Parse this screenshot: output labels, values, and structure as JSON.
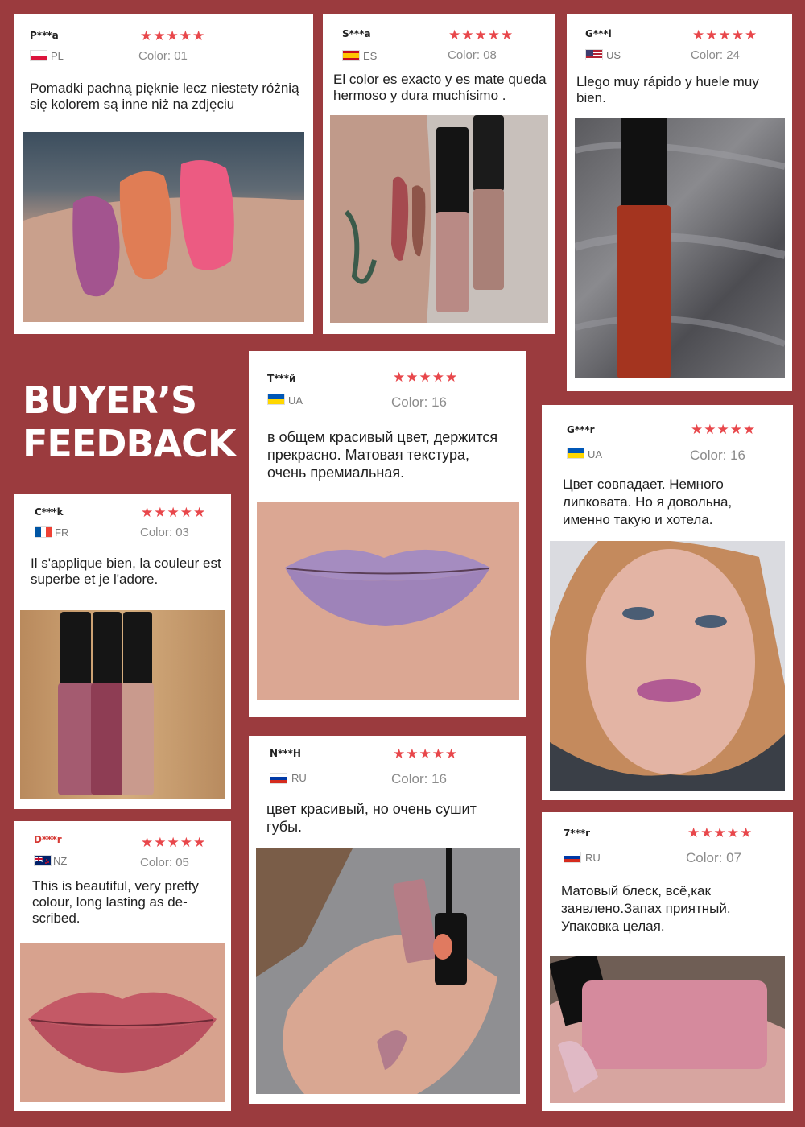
{
  "headline": {
    "line1": "BUYER’S",
    "line2": "FEEDBACK"
  },
  "colors": {
    "background": "#9b3b3e",
    "star": "#e8474b",
    "card": "#ffffff"
  },
  "reviews": [
    {
      "user": "P***a",
      "country": "PL",
      "stars": "★★★★★",
      "color_label": "Color:",
      "color_value": "01",
      "text": "Pomadki pachną pięknie lecz niestety różnią się kolorem są inne niż na zdjęciu"
    },
    {
      "user": "S***a",
      "country": "ES",
      "stars": "★★★★★",
      "color_label": "Color:",
      "color_value": "08",
      "text": "El color es exacto y es mate queda hermoso y dura muchísimo ."
    },
    {
      "user": "G***i",
      "country": "US",
      "stars": "★★★★★",
      "color_label": "Color:",
      "color_value": "24",
      "text": "Llego muy rápido y huele muy bien."
    },
    {
      "user": "Т***й",
      "country": "UA",
      "stars": "★★★★★",
      "color_label": "Color:",
      "color_value": "16",
      "text": "в общем красивый цвет, держится прекрасно. Матовая текстура, очень премиальная."
    },
    {
      "user": "G***r",
      "country": "UA",
      "stars": "★★★★★",
      "color_label": "Color:",
      "color_value": "16",
      "text": "Цвет совпадает. Немного липковата. Но я довольна, именно такую и хотела."
    },
    {
      "user": "C***k",
      "country": "FR",
      "stars": "★★★★★",
      "color_label": "Color:",
      "color_value": "03",
      "text": "Il s'applique bien, la couleur est superbe et je l'adore."
    },
    {
      "user": "N***H",
      "country": "RU",
      "stars": "★★★★★",
      "color_label": "Color:",
      "color_value": "16",
      "text": "цвет красивый, но очень сушит губы."
    },
    {
      "user": "D***r",
      "country": "NZ",
      "stars": "★★★★★",
      "color_label": "Color:",
      "color_value": "05",
      "text": "This is beautiful, very pretty colour, long lasting as de-scribed."
    },
    {
      "user": "7***r",
      "country": "RU",
      "stars": "★★★★★",
      "color_label": "Color:",
      "color_value": "07",
      "text": "Матовый блеск, всё,как заявлено.Запах приятный. Упаковка целая."
    }
  ]
}
